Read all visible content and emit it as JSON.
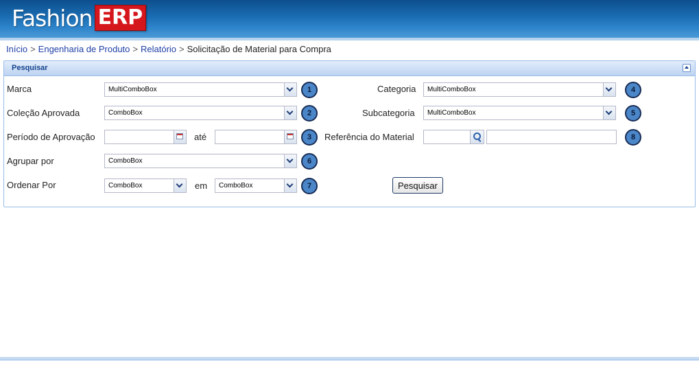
{
  "app": {
    "logo_word": "Fashion",
    "logo_badge": "ERP"
  },
  "breadcrumb": {
    "items": [
      "Início",
      "Engenharia de Produto",
      "Relatório"
    ],
    "current": "Solicitação de Material para Compra",
    "separator": ">"
  },
  "panel": {
    "title": "Pesquisar"
  },
  "form": {
    "marca": {
      "label": "Marca",
      "value": "MultiComboBox",
      "badge": "1"
    },
    "colecao": {
      "label": "Coleção Aprovada",
      "value": "ComboBox",
      "badge": "2"
    },
    "periodo": {
      "label": "Período de Aprovação",
      "between": "até",
      "from": "",
      "to": "",
      "badge": "3"
    },
    "agrupar": {
      "label": "Agrupar por",
      "value": "ComboBox",
      "badge": "6"
    },
    "ordenar": {
      "label": "Ordenar Por",
      "value": "ComboBox",
      "in_label": "em",
      "direction": "ComboBox",
      "badge": "7"
    },
    "categoria": {
      "label": "Categoria",
      "value": "MultiComboBox",
      "badge": "4"
    },
    "subcategoria": {
      "label": "Subcategoria",
      "value": "MultiComboBox",
      "badge": "5"
    },
    "referencia": {
      "label": "Referência do Material",
      "code": "",
      "description": "",
      "badge": "8"
    },
    "search_button": "Pesquisar"
  },
  "colors": {
    "header": "#1a6db3",
    "link": "#1f3fa6",
    "panel_border": "#99bbe8",
    "badge": "#4a86c8"
  }
}
